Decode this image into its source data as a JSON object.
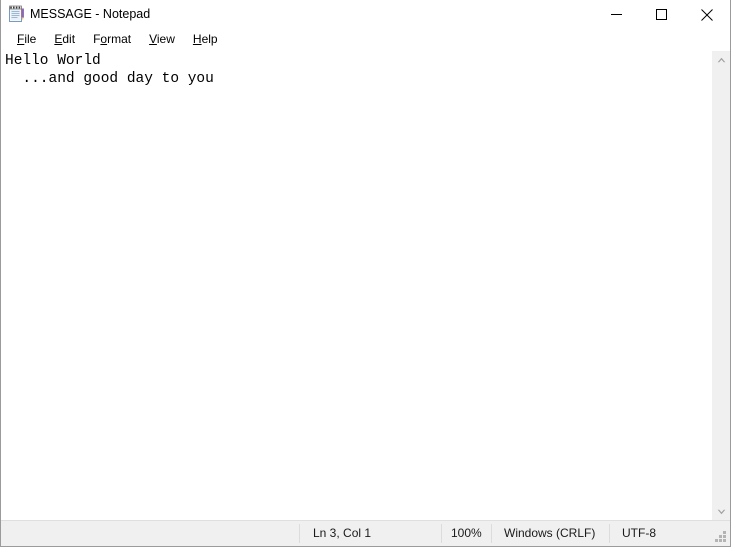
{
  "window": {
    "title": "MESSAGE - Notepad",
    "icon": "notepad-icon",
    "controls": {
      "minimize_label": "Minimize",
      "maximize_label": "Maximize",
      "close_label": "Close"
    }
  },
  "menubar": {
    "items": [
      {
        "label": "File",
        "accel": "F",
        "before": "",
        "after": "ile"
      },
      {
        "label": "Edit",
        "accel": "E",
        "before": "",
        "after": "dit"
      },
      {
        "label": "Format",
        "accel": "o",
        "before": "F",
        "after": "rmat"
      },
      {
        "label": "View",
        "accel": "V",
        "before": "",
        "after": "iew"
      },
      {
        "label": "Help",
        "accel": "H",
        "before": "",
        "after": "elp"
      }
    ]
  },
  "editor": {
    "content": "Hello World\n  ...and good day to you\n",
    "lines": [
      "Hello World",
      "  ...and good day to you",
      ""
    ]
  },
  "scrollbar": {
    "up_arrow": "chevron-up-icon",
    "down_arrow": "chevron-down-icon"
  },
  "statusbar": {
    "line_col": "Ln 3, Col 1",
    "zoom": "100%",
    "line_ending": "Windows (CRLF)",
    "encoding": "UTF-8"
  },
  "colors": {
    "window_bg": "#ffffff",
    "chrome_bg": "#f0f0f0",
    "border": "#9b9b9b",
    "separator": "#dcdcdc",
    "text": "#000000"
  }
}
